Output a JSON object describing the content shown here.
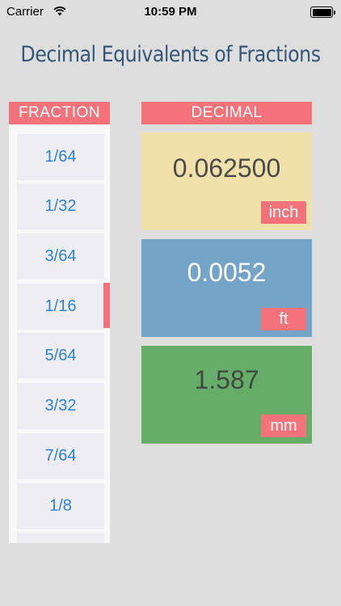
{
  "status_bar": {
    "carrier": "Carrier",
    "time": "10:59 PM"
  },
  "title": "Decimal Equivalents of Fractions",
  "headers": {
    "fraction": "FRACTION",
    "decimal": "DECIMAL"
  },
  "fractions": [
    "1/64",
    "1/32",
    "3/64",
    "1/16",
    "5/64",
    "3/32",
    "7/64",
    "1/8"
  ],
  "selected_fraction": "1/16",
  "decimal": {
    "inch": {
      "value": "0.062500",
      "unit": "inch",
      "color": "#f0e1aa"
    },
    "ft": {
      "value": "0.0052",
      "unit": "ft",
      "color": "#74a4c8"
    },
    "mm": {
      "value": "1.587",
      "unit": "mm",
      "color": "#65ad68"
    }
  },
  "colors": {
    "accent": "#f4737b",
    "title": "#35577a",
    "link": "#2e82d8"
  }
}
